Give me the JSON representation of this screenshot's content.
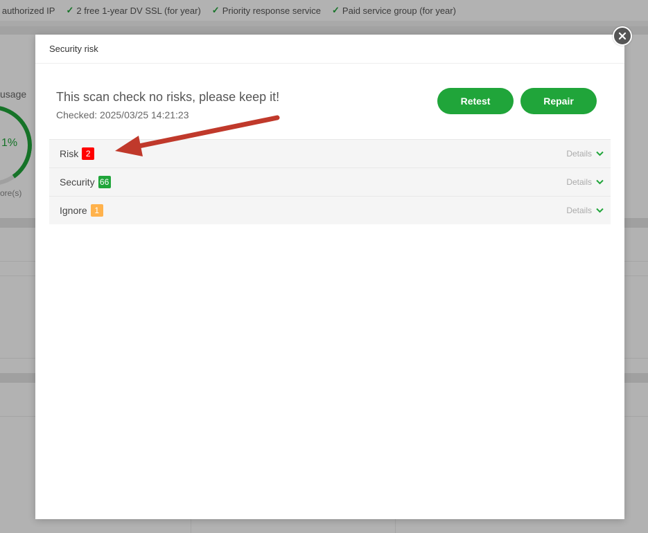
{
  "background": {
    "features": [
      "e authorized IP",
      "2 free 1-year DV SSL (for year)",
      "Priority response service",
      "Paid service group (for year)"
    ],
    "usage_label": "usage",
    "usage_percent": "1%",
    "score_label": "ore(s)"
  },
  "dialog": {
    "title": "Security risk",
    "message": "This scan check no risks, please keep it!",
    "checked": "Checked: 2025/03/25 14:21:23",
    "buttons": {
      "retest": "Retest",
      "repair": "Repair"
    },
    "rows": [
      {
        "label": "Risk",
        "count": "2",
        "badge_color": "#ff0000",
        "details": "Details"
      },
      {
        "label": "Security",
        "count": "66",
        "badge_color": "#20a53a",
        "details": "Details"
      },
      {
        "label": "Ignore",
        "count": "1",
        "badge_color": "#ffb24c",
        "details": "Details"
      }
    ]
  },
  "annotation": {
    "arrow_color": "#c0392b"
  },
  "colors": {
    "accent": "#20a53a"
  }
}
